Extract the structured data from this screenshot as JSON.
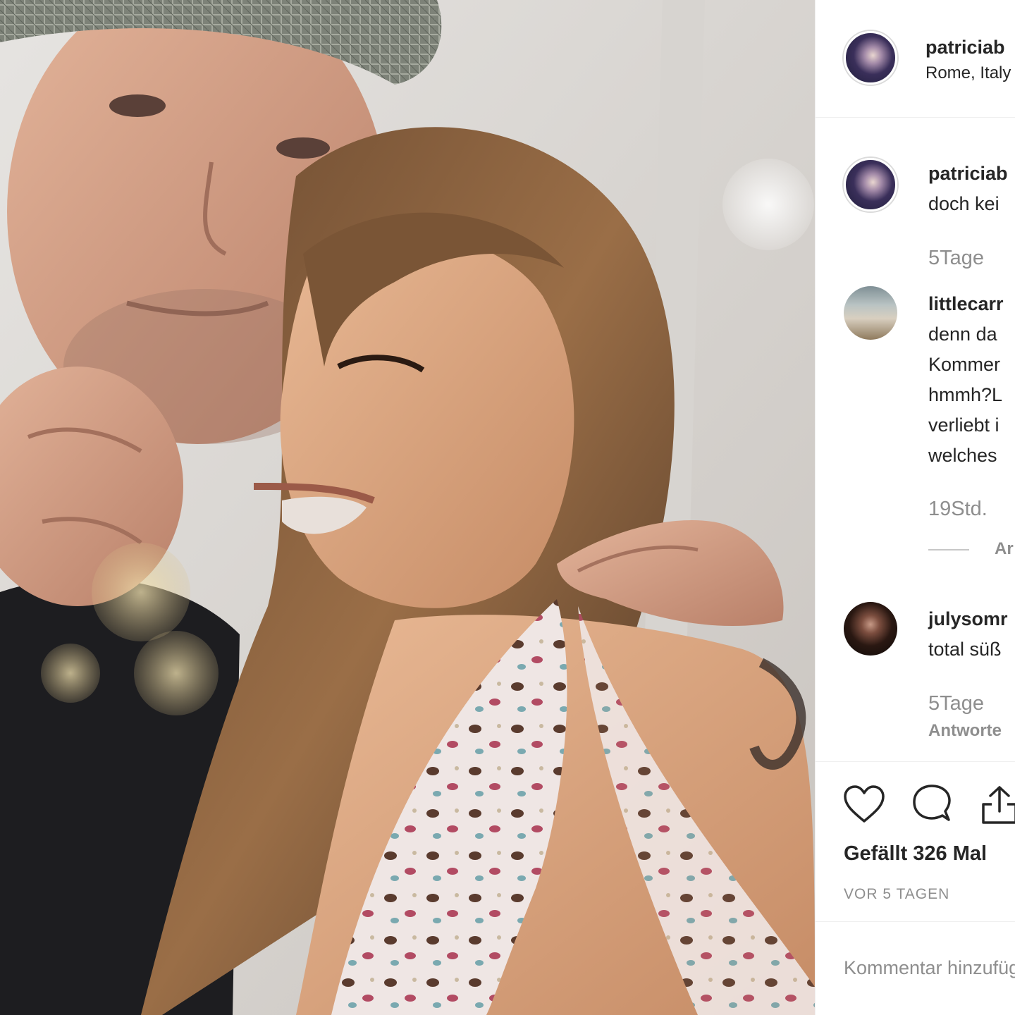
{
  "post": {
    "username": "patriciab",
    "location": "Rome, Italy"
  },
  "comments": [
    {
      "username": "patriciab",
      "lines": [
        "doch kei"
      ],
      "time": "5Tage",
      "avatar": "purple"
    },
    {
      "username": "littlecarr",
      "lines": [
        "denn da",
        "Kommer",
        "hmmh?L",
        "verliebt i",
        "welches"
      ],
      "time": "19Std.",
      "view_replies": "Ar",
      "avatar": "beach"
    },
    {
      "username": "julysomr",
      "lines": [
        "total süß"
      ],
      "time": "5Tage",
      "reply": "Antworte",
      "avatar": "dark"
    }
  ],
  "actions": {
    "like_icon": "heart-icon",
    "comment_icon": "comment-bubble-icon",
    "share_icon": "share-icon",
    "likes_text": "Gefällt 326 Mal",
    "date_text": "VOR 5 TAGEN"
  },
  "add_comment": {
    "placeholder": "Kommentar hinzufügen ..."
  },
  "colors": {
    "text": "#262626",
    "secondary": "#8e8e8e",
    "divider": "#efefef"
  }
}
